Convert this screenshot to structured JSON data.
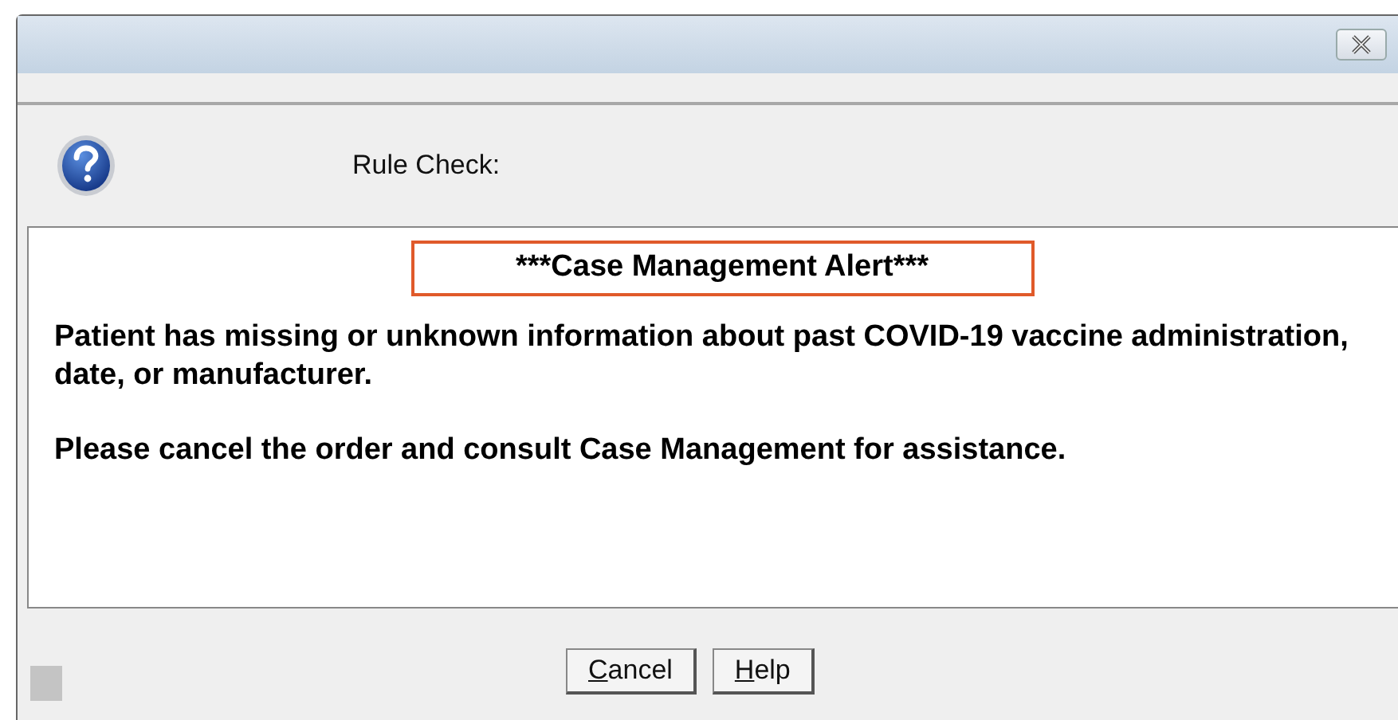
{
  "dialog": {
    "heading": "Rule Check:"
  },
  "message": {
    "alert_title": "***Case Management Alert***",
    "paragraphs": [
      "Patient has missing or unknown information about past COVID-19 vaccine administration, date, or manufacturer.",
      "Please cancel the order and consult Case Management for assistance."
    ]
  },
  "buttons": [
    {
      "access_key": "C",
      "label_rest": "ancel"
    },
    {
      "access_key": "H",
      "label_rest": "elp"
    }
  ]
}
